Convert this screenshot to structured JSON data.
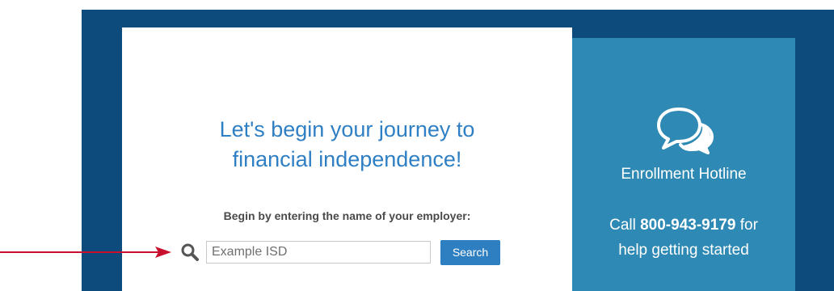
{
  "main": {
    "headline_line1": "Let's begin your journey to",
    "headline_line2": "financial independence!",
    "prompt": "Begin by entering the name of your employer:",
    "search": {
      "icon": "search-icon",
      "placeholder": "Example ISD",
      "button_label": "Search"
    }
  },
  "hotline": {
    "icon": "chat-bubbles-icon",
    "title": "Enrollment Hotline",
    "call_prefix": "Call",
    "phone": "800-943-9179",
    "call_suffix": "for",
    "line2": "help getting started"
  },
  "colors": {
    "frame": "#0d4b7c",
    "panel": "#2e89b4",
    "headline": "#2f7fc4",
    "button": "#2e7fc1",
    "arrow": "#c8102e"
  }
}
